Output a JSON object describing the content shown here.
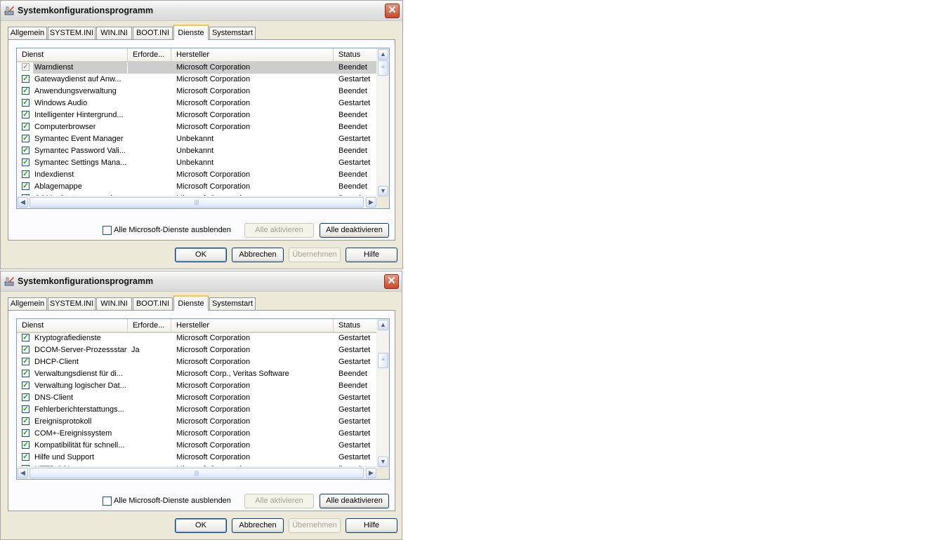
{
  "windows": [
    {
      "title": "Systemkonfigurationsprogramm",
      "tabs": [
        "Allgemein",
        "SYSTEM.INI",
        "WIN.INI",
        "BOOT.INI",
        "Dienste",
        "Systemstart"
      ],
      "active_tab": "Dienste",
      "columns": [
        "Dienst",
        "Erforde...",
        "Hersteller",
        "Status"
      ],
      "rows": [
        {
          "name": "Warndienst",
          "required": "",
          "manufacturer": "Microsoft Corporation",
          "status": "Beendet",
          "selected": true
        },
        {
          "name": "Gatewaydienst auf Anw...",
          "required": "",
          "manufacturer": "Microsoft Corporation",
          "status": "Gestartet"
        },
        {
          "name": "Anwendungsverwaltung",
          "required": "",
          "manufacturer": "Microsoft Corporation",
          "status": "Beendet"
        },
        {
          "name": "Windows Audio",
          "required": "",
          "manufacturer": "Microsoft Corporation",
          "status": "Gestartet"
        },
        {
          "name": "Intelligenter Hintergrund...",
          "required": "",
          "manufacturer": "Microsoft Corporation",
          "status": "Beendet"
        },
        {
          "name": "Computerbrowser",
          "required": "",
          "manufacturer": "Microsoft Corporation",
          "status": "Beendet"
        },
        {
          "name": "Symantec Event Manager",
          "required": "",
          "manufacturer": "Unbekannt",
          "status": "Gestartet"
        },
        {
          "name": "Symantec Password Vali...",
          "required": "",
          "manufacturer": "Unbekannt",
          "status": "Beendet"
        },
        {
          "name": "Symantec Settings Mana...",
          "required": "",
          "manufacturer": "Unbekannt",
          "status": "Gestartet"
        },
        {
          "name": "Indexdienst",
          "required": "",
          "manufacturer": "Microsoft Corporation",
          "status": "Beendet"
        },
        {
          "name": "Ablagemappe",
          "required": "",
          "manufacturer": "Microsoft Corporation",
          "status": "Beendet"
        },
        {
          "name": "COM+-Systemanwendung",
          "required": "",
          "manufacturer": "Microsoft Corporation",
          "status": "Beendet"
        }
      ],
      "scroll_fraction": 0.0,
      "hide_ms_label": "Alle Microsoft-Dienste ausblenden",
      "buttons": {
        "enable_all": "Alle aktivieren",
        "disable_all": "Alle deaktivieren",
        "ok": "OK",
        "cancel": "Abbrechen",
        "apply": "Übernehmen",
        "help": "Hilfe"
      }
    },
    {
      "title": "Systemkonfigurationsprogramm",
      "tabs": [
        "Allgemein",
        "SYSTEM.INI",
        "WIN.INI",
        "BOOT.INI",
        "Dienste",
        "Systemstart"
      ],
      "active_tab": "Dienste",
      "columns": [
        "Dienst",
        "Erforde...",
        "Hersteller",
        "Status"
      ],
      "rows": [
        {
          "name": "Kryptografiedienste",
          "required": "",
          "manufacturer": "Microsoft Corporation",
          "status": "Gestartet"
        },
        {
          "name": "DCOM-Server-Prozessstart",
          "required": "Ja",
          "manufacturer": "Microsoft Corporation",
          "status": "Gestartet"
        },
        {
          "name": "DHCP-Client",
          "required": "",
          "manufacturer": "Microsoft Corporation",
          "status": "Gestartet"
        },
        {
          "name": "Verwaltungsdienst für di...",
          "required": "",
          "manufacturer": "Microsoft Corp., Veritas Software",
          "status": "Beendet"
        },
        {
          "name": "Verwaltung logischer Dat...",
          "required": "",
          "manufacturer": "Microsoft Corporation",
          "status": "Beendet"
        },
        {
          "name": "DNS-Client",
          "required": "",
          "manufacturer": "Microsoft Corporation",
          "status": "Gestartet"
        },
        {
          "name": "Fehlerberichterstattungs...",
          "required": "",
          "manufacturer": "Microsoft Corporation",
          "status": "Gestartet"
        },
        {
          "name": "Ereignisprotokoll",
          "required": "",
          "manufacturer": "Microsoft Corporation",
          "status": "Gestartet"
        },
        {
          "name": "COM+-Ereignissystem",
          "required": "",
          "manufacturer": "Microsoft Corporation",
          "status": "Gestartet"
        },
        {
          "name": "Kompatibilität für schnell...",
          "required": "",
          "manufacturer": "Microsoft Corporation",
          "status": "Gestartet"
        },
        {
          "name": "Hilfe und Support",
          "required": "",
          "manufacturer": "Microsoft Corporation",
          "status": "Gestartet"
        },
        {
          "name": "HTTP-SSL",
          "required": "",
          "manufacturer": "Microsoft Corporation",
          "status": "Beendet"
        }
      ],
      "scroll_fraction": 0.2,
      "hide_ms_label": "Alle Microsoft-Dienste ausblenden",
      "buttons": {
        "enable_all": "Alle aktivieren",
        "disable_all": "Alle deaktivieren",
        "ok": "OK",
        "cancel": "Abbrechen",
        "apply": "Übernehmen",
        "help": "Hilfe"
      }
    }
  ],
  "icons": {
    "app": "msconfig-icon",
    "close": "close-icon",
    "check": "check-icon"
  },
  "colors": {
    "title_text": "#111111",
    "close_red": "#c94a2d",
    "active_tab_accent": "#ffc83c",
    "check_green": "#21a121",
    "selection_gray": "#cdcdcd"
  }
}
